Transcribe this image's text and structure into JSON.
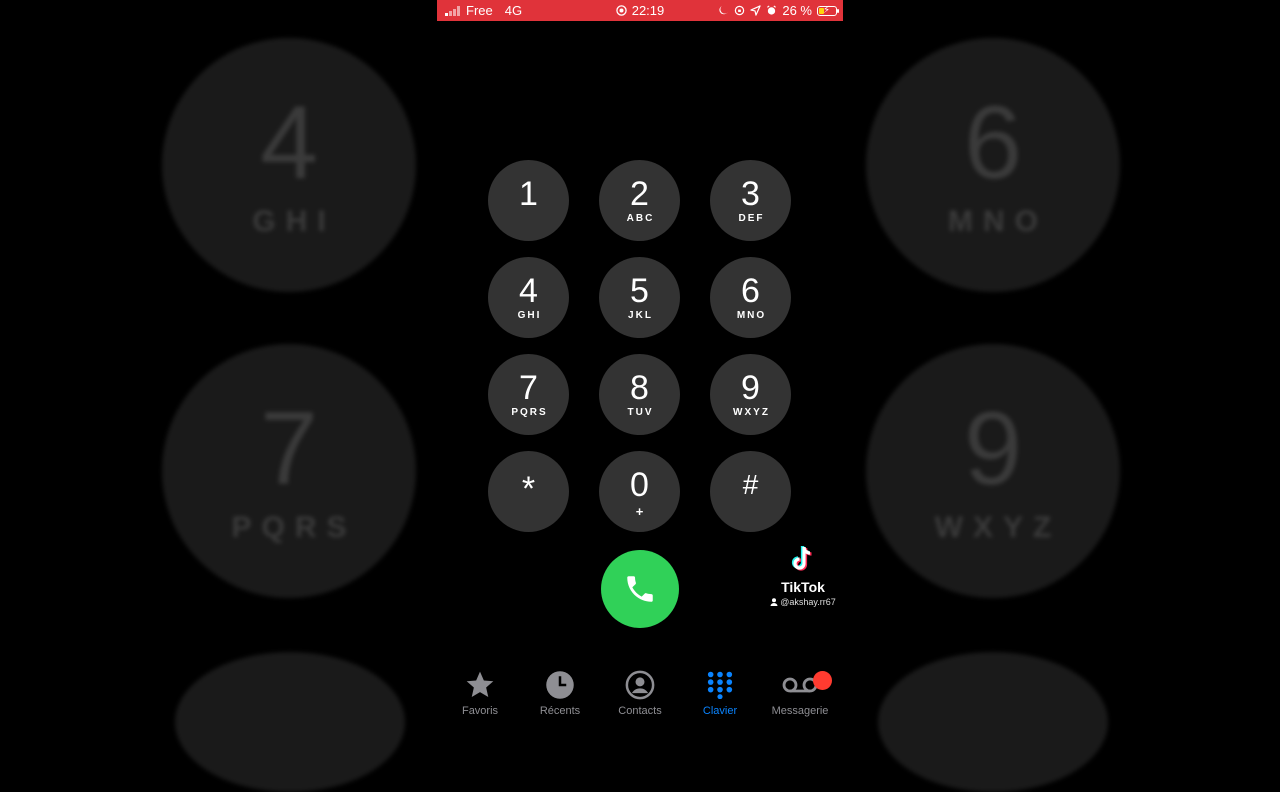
{
  "status_bar": {
    "carrier": "Free",
    "network": "4G",
    "time": "22:19",
    "battery": "26 %"
  },
  "background_keys": [
    {
      "digit": "4",
      "letters": "GHI"
    },
    {
      "digit": "6",
      "letters": "MNO"
    },
    {
      "digit": "7",
      "letters": "PQRS"
    },
    {
      "digit": "9",
      "letters": "WXYZ"
    }
  ],
  "keypad": [
    {
      "digit": "1",
      "letters": ""
    },
    {
      "digit": "2",
      "letters": "ABC"
    },
    {
      "digit": "3",
      "letters": "DEF"
    },
    {
      "digit": "4",
      "letters": "GHI"
    },
    {
      "digit": "5",
      "letters": "JKL"
    },
    {
      "digit": "6",
      "letters": "MNO"
    },
    {
      "digit": "7",
      "letters": "PQRS"
    },
    {
      "digit": "8",
      "letters": "TUV"
    },
    {
      "digit": "9",
      "letters": "WXYZ"
    },
    {
      "digit": "*",
      "letters": ""
    },
    {
      "digit": "0",
      "letters": "+"
    },
    {
      "digit": "#",
      "letters": ""
    }
  ],
  "watermark": {
    "app": "TikTok",
    "user": "@akshay.rr67"
  },
  "tabs": [
    {
      "label": "Favoris",
      "icon": "star-icon"
    },
    {
      "label": "Récents",
      "icon": "clock-icon"
    },
    {
      "label": "Contacts",
      "icon": "contact-icon"
    },
    {
      "label": "Clavier",
      "icon": "keypad-icon",
      "active": true
    },
    {
      "label": "Messagerie",
      "icon": "voicemail-icon"
    }
  ],
  "colors": {
    "status_bar": "#e0333a",
    "key": "#333333",
    "call": "#30d158",
    "active_tab": "#0a84ff",
    "inactive_tab": "#8e8e93",
    "badge": "#ff3b30"
  }
}
